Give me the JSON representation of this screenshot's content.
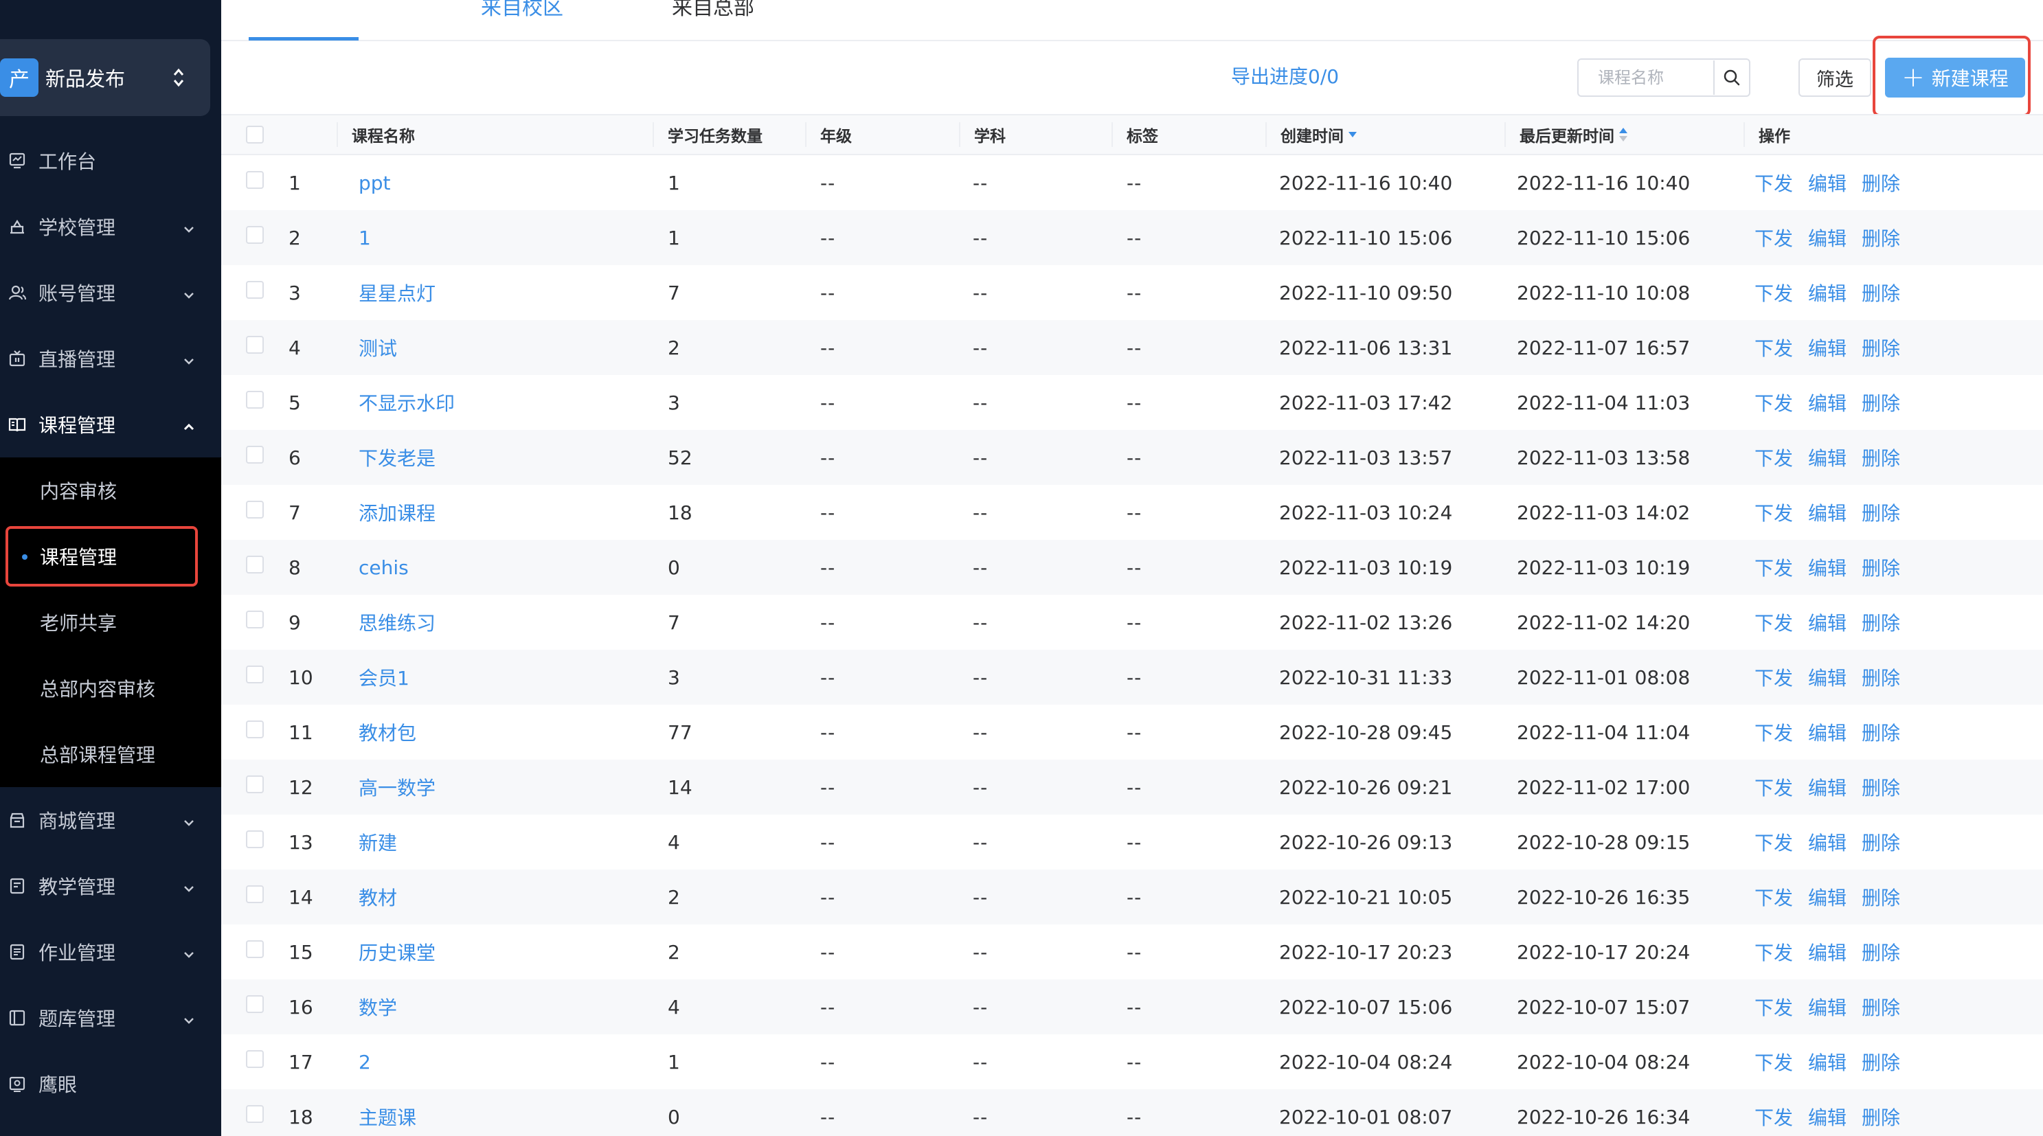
{
  "product": {
    "logo_char": "产",
    "name": "新品发布"
  },
  "sidebar": {
    "items": [
      {
        "id": "workbench",
        "label": "工作台",
        "icon": "dashboard-icon",
        "has_chevron": false
      },
      {
        "id": "school",
        "label": "学校管理",
        "icon": "school-icon",
        "has_chevron": true
      },
      {
        "id": "account",
        "label": "账号管理",
        "icon": "user-icon",
        "has_chevron": true
      },
      {
        "id": "live",
        "label": "直播管理",
        "icon": "live-tv-icon",
        "has_chevron": true
      },
      {
        "id": "course",
        "label": "课程管理",
        "icon": "book-icon",
        "has_chevron": true,
        "open": true
      }
    ],
    "course_sub": [
      {
        "label": "内容审核"
      },
      {
        "label": "课程管理",
        "active": true
      },
      {
        "label": "老师共享"
      },
      {
        "label": "总部内容审核"
      },
      {
        "label": "总部课程管理"
      }
    ],
    "items_after": [
      {
        "id": "mall",
        "label": "商城管理",
        "icon": "shop-icon",
        "has_chevron": true
      },
      {
        "id": "teaching",
        "label": "教学管理",
        "icon": "teaching-icon",
        "has_chevron": true
      },
      {
        "id": "homework",
        "label": "作业管理",
        "icon": "homework-icon",
        "has_chevron": true
      },
      {
        "id": "questions",
        "label": "题库管理",
        "icon": "question-bank-icon",
        "has_chevron": true
      },
      {
        "id": "eagle",
        "label": "鹰眼",
        "icon": "eye-icon",
        "has_chevron": false
      }
    ]
  },
  "tabs": [
    {
      "label": "来自校区",
      "active": true
    },
    {
      "label": "来自总部",
      "active": false
    }
  ],
  "toolbar": {
    "export_label": "导出进度0/0",
    "search_placeholder": "课程名称",
    "filter_label": "筛选",
    "new_label": "新建课程"
  },
  "table": {
    "headers": {
      "name": "课程名称",
      "tasks": "学习任务数量",
      "grade": "年级",
      "subject": "学科",
      "tags": "标签",
      "created": "创建时间",
      "updated": "最后更新时间",
      "ops": "操作"
    },
    "ops_labels": [
      "下发",
      "编辑",
      "删除"
    ],
    "rows": [
      {
        "idx": "1",
        "name": "ppt",
        "tasks": "1",
        "grade": "--",
        "subject": "--",
        "tags": "--",
        "created": "2022-11-16 10:40",
        "updated": "2022-11-16 10:40"
      },
      {
        "idx": "2",
        "name": "1",
        "tasks": "1",
        "grade": "--",
        "subject": "--",
        "tags": "--",
        "created": "2022-11-10 15:06",
        "updated": "2022-11-10 15:06"
      },
      {
        "idx": "3",
        "name": "星星点灯",
        "tasks": "7",
        "grade": "--",
        "subject": "--",
        "tags": "--",
        "created": "2022-11-10 09:50",
        "updated": "2022-11-10 10:08"
      },
      {
        "idx": "4",
        "name": "测试",
        "tasks": "2",
        "grade": "--",
        "subject": "--",
        "tags": "--",
        "created": "2022-11-06 13:31",
        "updated": "2022-11-07 16:57"
      },
      {
        "idx": "5",
        "name": "不显示水印",
        "tasks": "3",
        "grade": "--",
        "subject": "--",
        "tags": "--",
        "created": "2022-11-03 17:42",
        "updated": "2022-11-04 11:03"
      },
      {
        "idx": "6",
        "name": "下发老是",
        "tasks": "52",
        "grade": "--",
        "subject": "--",
        "tags": "--",
        "created": "2022-11-03 13:57",
        "updated": "2022-11-03 13:58"
      },
      {
        "idx": "7",
        "name": "添加课程",
        "tasks": "18",
        "grade": "--",
        "subject": "--",
        "tags": "--",
        "created": "2022-11-03 10:24",
        "updated": "2022-11-03 14:02"
      },
      {
        "idx": "8",
        "name": "cehis",
        "tasks": "0",
        "grade": "--",
        "subject": "--",
        "tags": "--",
        "created": "2022-11-03 10:19",
        "updated": "2022-11-03 10:19"
      },
      {
        "idx": "9",
        "name": "思维练习",
        "tasks": "7",
        "grade": "--",
        "subject": "--",
        "tags": "--",
        "created": "2022-11-02 13:26",
        "updated": "2022-11-02 14:20"
      },
      {
        "idx": "10",
        "name": "会员1",
        "tasks": "3",
        "grade": "--",
        "subject": "--",
        "tags": "--",
        "created": "2022-10-31 11:33",
        "updated": "2022-11-01 08:08"
      },
      {
        "idx": "11",
        "name": "教材包",
        "tasks": "77",
        "grade": "--",
        "subject": "--",
        "tags": "--",
        "created": "2022-10-28 09:45",
        "updated": "2022-11-04 11:04"
      },
      {
        "idx": "12",
        "name": "高一数学",
        "tasks": "14",
        "grade": "--",
        "subject": "--",
        "tags": "--",
        "created": "2022-10-26 09:21",
        "updated": "2022-11-02 17:00"
      },
      {
        "idx": "13",
        "name": "新建",
        "tasks": "4",
        "grade": "--",
        "subject": "--",
        "tags": "--",
        "created": "2022-10-26 09:13",
        "updated": "2022-10-28 09:15"
      },
      {
        "idx": "14",
        "name": "教材",
        "tasks": "2",
        "grade": "--",
        "subject": "--",
        "tags": "--",
        "created": "2022-10-21 10:05",
        "updated": "2022-10-26 16:35"
      },
      {
        "idx": "15",
        "name": "历史课堂",
        "tasks": "2",
        "grade": "--",
        "subject": "--",
        "tags": "--",
        "created": "2022-10-17 20:23",
        "updated": "2022-10-17 20:24"
      },
      {
        "idx": "16",
        "name": "数学",
        "tasks": "4",
        "grade": "--",
        "subject": "--",
        "tags": "--",
        "created": "2022-10-07 15:06",
        "updated": "2022-10-07 15:07"
      },
      {
        "idx": "17",
        "name": "2",
        "tasks": "1",
        "grade": "--",
        "subject": "--",
        "tags": "--",
        "created": "2022-10-04 08:24",
        "updated": "2022-10-04 08:24"
      },
      {
        "idx": "18",
        "name": "主题课",
        "tasks": "0",
        "grade": "--",
        "subject": "--",
        "tags": "--",
        "created": "2022-10-01 08:07",
        "updated": "2022-10-26 16:34"
      }
    ]
  },
  "colors": {
    "accent": "#3a8ee6",
    "sidebar_bg": "#0f1a2d",
    "highlight": "#e8453c"
  }
}
